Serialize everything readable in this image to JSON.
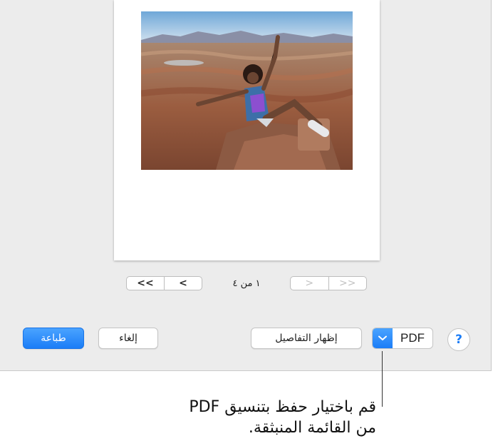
{
  "preview": {
    "photo_alt": ""
  },
  "pager": {
    "first_label": "<<",
    "prev_label": "<",
    "next_label": ">",
    "last_label": ">>",
    "page_count": "١ من ٤"
  },
  "buttons": {
    "print_label": "طباعة",
    "cancel_label": "إلغاء",
    "show_details_label": "إظهار التفاصيل",
    "pdf_label": "PDF",
    "help_label": "?"
  },
  "callout": {
    "line1": "قم باختيار حفظ بتنسيق PDF",
    "line2": "من القائمة المنبثقة."
  },
  "colors": {
    "accent": "#1b7df7",
    "dialog_bg": "#ececec"
  },
  "icons": {
    "pdf_dropdown": "chevron-down-icon",
    "help": "question-mark-icon"
  }
}
